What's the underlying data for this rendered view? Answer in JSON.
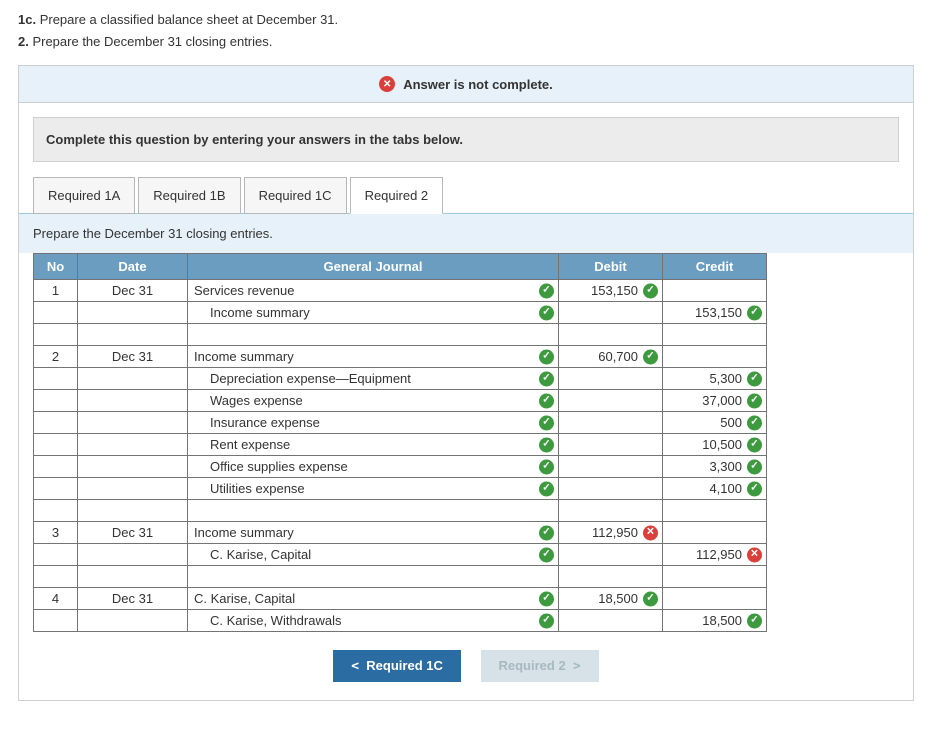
{
  "question": {
    "line1_prefix": "1c.",
    "line1_text": " Prepare a classified balance sheet at December 31.",
    "line2_prefix": "2.",
    "line2_text": " Prepare the December 31 closing entries."
  },
  "status_text": "Answer is not complete.",
  "instruction_text": "Complete this question by entering your answers in the tabs below.",
  "tabs": {
    "t0": "Required 1A",
    "t1": "Required 1B",
    "t2": "Required 1C",
    "t3": "Required 2"
  },
  "tab_instruction": "Prepare the December 31 closing entries.",
  "headers": {
    "no": "No",
    "date": "Date",
    "gj": "General Journal",
    "debit": "Debit",
    "credit": "Credit"
  },
  "rows": {
    "r1": {
      "no": "1",
      "date": "Dec 31",
      "gj": "Services revenue",
      "indent": 0,
      "gj_ok": true,
      "debit": "153,150",
      "debit_ok": true,
      "credit": "",
      "credit_ok": null
    },
    "r2": {
      "no": "",
      "date": "",
      "gj": "Income summary",
      "indent": 1,
      "gj_ok": true,
      "debit": "",
      "debit_ok": null,
      "credit": "153,150",
      "credit_ok": true
    },
    "r3": {
      "no": "",
      "date": "",
      "gj": "",
      "indent": 0,
      "gj_ok": null,
      "debit": "",
      "debit_ok": null,
      "credit": "",
      "credit_ok": null
    },
    "r4": {
      "no": "2",
      "date": "Dec 31",
      "gj": "Income summary",
      "indent": 0,
      "gj_ok": true,
      "debit": "60,700",
      "debit_ok": true,
      "credit": "",
      "credit_ok": null
    },
    "r5": {
      "no": "",
      "date": "",
      "gj": "Depreciation expense—Equipment",
      "indent": 1,
      "gj_ok": true,
      "debit": "",
      "debit_ok": null,
      "credit": "5,300",
      "credit_ok": true
    },
    "r6": {
      "no": "",
      "date": "",
      "gj": "Wages expense",
      "indent": 1,
      "gj_ok": true,
      "debit": "",
      "debit_ok": null,
      "credit": "37,000",
      "credit_ok": true
    },
    "r7": {
      "no": "",
      "date": "",
      "gj": "Insurance expense",
      "indent": 1,
      "gj_ok": true,
      "debit": "",
      "debit_ok": null,
      "credit": "500",
      "credit_ok": true
    },
    "r8": {
      "no": "",
      "date": "",
      "gj": "Rent expense",
      "indent": 1,
      "gj_ok": true,
      "debit": "",
      "debit_ok": null,
      "credit": "10,500",
      "credit_ok": true
    },
    "r9": {
      "no": "",
      "date": "",
      "gj": "Office supplies expense",
      "indent": 1,
      "gj_ok": true,
      "debit": "",
      "debit_ok": null,
      "credit": "3,300",
      "credit_ok": true
    },
    "r10": {
      "no": "",
      "date": "",
      "gj": "Utilities expense",
      "indent": 1,
      "gj_ok": true,
      "debit": "",
      "debit_ok": null,
      "credit": "4,100",
      "credit_ok": true
    },
    "r11": {
      "no": "",
      "date": "",
      "gj": "",
      "indent": 0,
      "gj_ok": null,
      "debit": "",
      "debit_ok": null,
      "credit": "",
      "credit_ok": null
    },
    "r12": {
      "no": "3",
      "date": "Dec 31",
      "gj": "Income summary",
      "indent": 0,
      "gj_ok": true,
      "debit": "112,950",
      "debit_ok": false,
      "credit": "",
      "credit_ok": null
    },
    "r13": {
      "no": "",
      "date": "",
      "gj": "C. Karise, Capital",
      "indent": 1,
      "gj_ok": true,
      "debit": "",
      "debit_ok": null,
      "credit": "112,950",
      "credit_ok": false
    },
    "r14": {
      "no": "",
      "date": "",
      "gj": "",
      "indent": 0,
      "gj_ok": null,
      "debit": "",
      "debit_ok": null,
      "credit": "",
      "credit_ok": null
    },
    "r15": {
      "no": "4",
      "date": "Dec 31",
      "gj": "C. Karise, Capital",
      "indent": 0,
      "gj_ok": true,
      "debit": "18,500",
      "debit_ok": true,
      "credit": "",
      "credit_ok": null
    },
    "r16": {
      "no": "",
      "date": "",
      "gj": "C. Karise, Withdrawals",
      "indent": 1,
      "gj_ok": true,
      "debit": "",
      "debit_ok": null,
      "credit": "18,500",
      "credit_ok": true
    }
  },
  "nav": {
    "prev": "Required 1C",
    "next": "Required 2"
  }
}
